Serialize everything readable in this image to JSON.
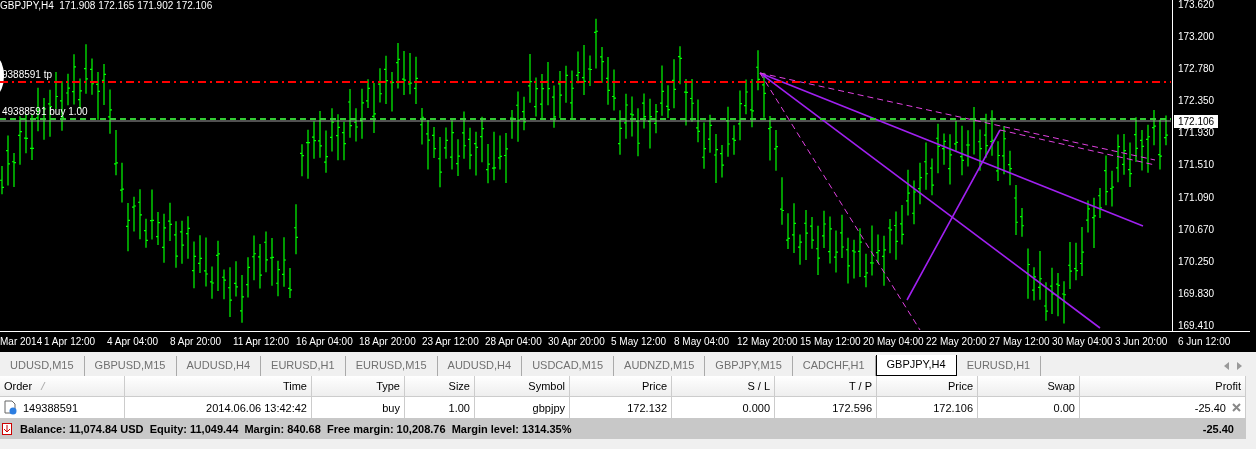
{
  "chart": {
    "title": "GBPJPY,H4  171.908 172.165 171.902 172.106",
    "order_lines": [
      {
        "kind": "tp",
        "label": "9388591 tp",
        "color": "#ff0000"
      },
      {
        "kind": "entry",
        "label": "49388591 buy 1.00",
        "color": "#32cd32"
      }
    ],
    "price_ticks": [
      "173.620",
      "173.200",
      "172.780",
      "172.350",
      "171.930",
      "171.510",
      "171.090",
      "170.670",
      "170.250",
      "169.830",
      "169.410"
    ],
    "current_price": "172.106",
    "time_labels": [
      "Mar 2014",
      "1 Apr 12:00",
      "4 Apr 04:00",
      "8 Apr 20:00",
      "11 Apr 12:00",
      "16 Apr 04:00",
      "18 Apr 20:00",
      "23 Apr 12:00",
      "28 Apr 04:00",
      "30 Apr 20:00",
      "5 May 12:00",
      "8 May 04:00",
      "12 May 20:00",
      "15 May 12:00",
      "20 May 04:00",
      "22 May 20:00",
      "27 May 12:00",
      "30 May 04:00",
      "3 Jun 20:00",
      "6 Jun 12:00"
    ]
  },
  "chart_tabs": [
    {
      "label": "UDUSD,M15",
      "selected": false
    },
    {
      "label": "GBPUSD,M15",
      "selected": false
    },
    {
      "label": "AUDUSD,H4",
      "selected": false
    },
    {
      "label": "EURUSD,H1",
      "selected": false
    },
    {
      "label": "EURUSD,M15",
      "selected": false
    },
    {
      "label": "AUDUSD,H4",
      "selected": false
    },
    {
      "label": "USDCAD,M15",
      "selected": false
    },
    {
      "label": "AUDNZD,M15",
      "selected": false
    },
    {
      "label": "GBPJPY,M15",
      "selected": false
    },
    {
      "label": "CADCHF,H1",
      "selected": false
    },
    {
      "label": "GBPJPY,H4",
      "selected": true
    },
    {
      "label": "EURUSD,H1",
      "selected": false
    }
  ],
  "table": {
    "columns": [
      "Order",
      "Time",
      "Type",
      "Size",
      "Symbol",
      "Price",
      "S / L",
      "T / P",
      "Price",
      "Swap",
      "Profit"
    ],
    "rows": [
      {
        "cells": [
          "149388591",
          "2014.06.06 13:42:42",
          "buy",
          "1.00",
          "gbpjpy",
          "172.132",
          "0.000",
          "172.596",
          "172.106",
          "0.00",
          "-25.40"
        ]
      }
    ],
    "summary": {
      "text": "Balance: 11,074.84 USD  Equity: 11,049.44  Margin: 840.68  Free margin: 10,208.76  Margin level: 1314.35%",
      "profit": "-25.40"
    }
  }
}
